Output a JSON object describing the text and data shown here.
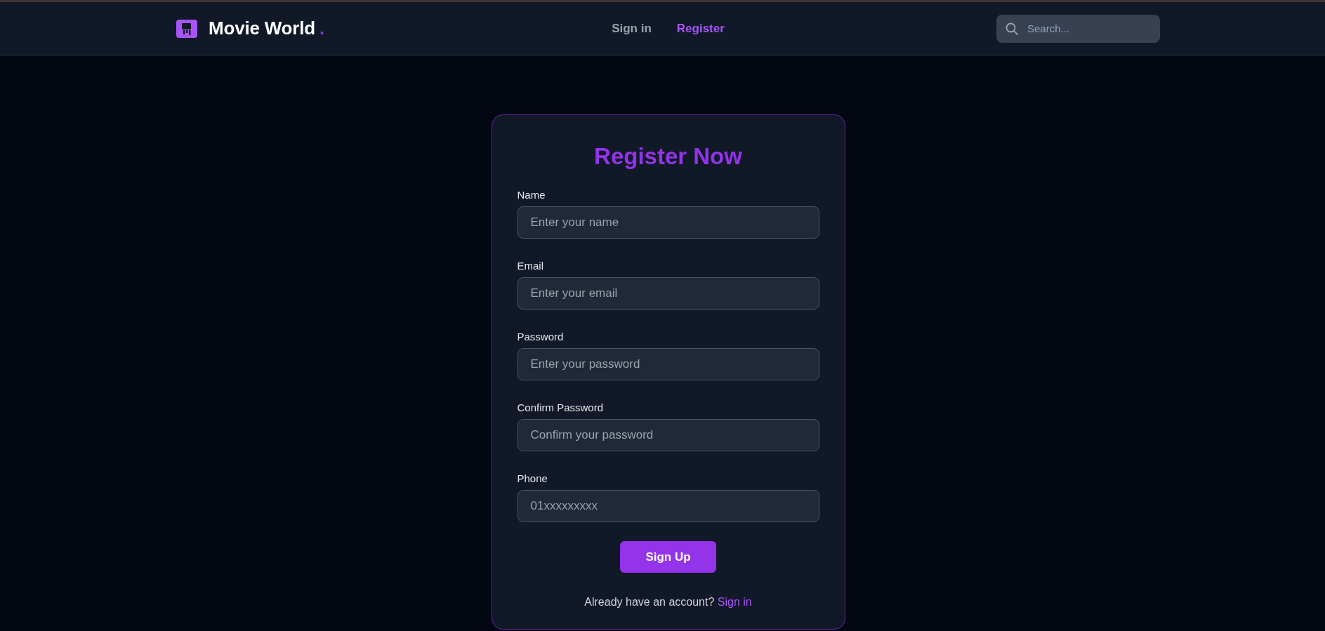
{
  "header": {
    "brand": {
      "name": "Movie World",
      "accent": "."
    },
    "nav": [
      {
        "label": "Sign in",
        "selected": false
      },
      {
        "label": "Register",
        "selected": true
      }
    ],
    "search": {
      "placeholder": "Search..."
    }
  },
  "form": {
    "title": "Register Now",
    "fields": [
      {
        "label": "Name",
        "placeholder": "Enter your name"
      },
      {
        "label": "Email",
        "placeholder": "Enter your email"
      },
      {
        "label": "Password",
        "placeholder": "Enter your password"
      },
      {
        "label": "Confirm Password",
        "placeholder": "Confirm your password"
      },
      {
        "label": "Phone",
        "placeholder": "01xxxxxxxxx"
      }
    ],
    "submit": "Sign Up",
    "footer": {
      "text": "Already have an account?",
      "link": "Sign in"
    }
  }
}
